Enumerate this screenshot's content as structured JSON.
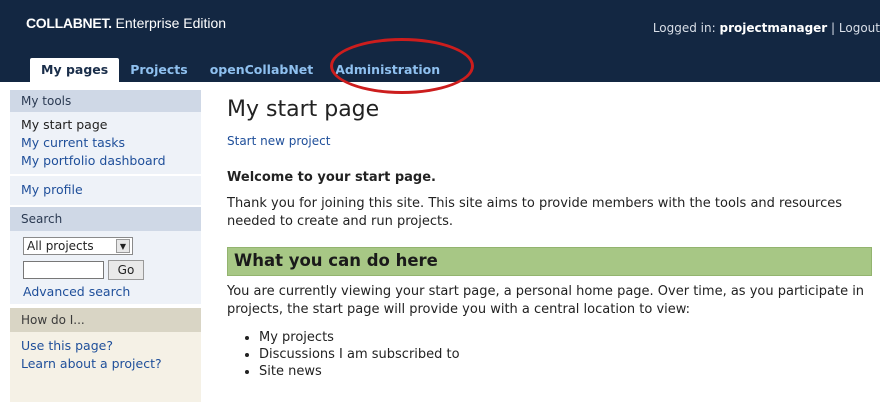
{
  "header": {
    "brand_bold": "COLLABNET.",
    "brand_rest": " Enterprise Edition",
    "login_prefix": "Logged in: ",
    "username": "projectmanager",
    "separator": " | ",
    "logout": "Logout"
  },
  "tabs": [
    {
      "label": "My pages"
    },
    {
      "label": "Projects"
    },
    {
      "label": "openCollabNet"
    },
    {
      "label": "Administration"
    }
  ],
  "sidebar": {
    "my_tools": {
      "heading": "My tools",
      "items": [
        "My start page",
        "My current tasks",
        "My portfolio dashboard"
      ],
      "profile": "My profile"
    },
    "search": {
      "heading": "Search",
      "scope": "All projects",
      "go": "Go",
      "advanced": "Advanced search"
    },
    "how": {
      "heading": "How do I...",
      "items": [
        "Use this page?",
        "Learn about a project?"
      ]
    }
  },
  "main": {
    "title": "My start page",
    "new_project": "Start new project",
    "welcome": "Welcome to your start page.",
    "intro": "Thank you for joining this site. This site aims to provide members with the tools and resources needed to create and run projects.",
    "section_title": "What you can do here",
    "body": "You are currently viewing your start page, a personal home page. Over time, as you participate in projects, the start page will provide you with a central location to view:",
    "list": [
      "My projects",
      "Discussions I am subscribed to",
      "Site news"
    ]
  },
  "colors": {
    "header_bg": "#132742",
    "tab_text": "#8fc0ef",
    "link": "#1f4f9a",
    "section_bg": "#a7c785",
    "highlight_circle": "#cc1d1d"
  }
}
